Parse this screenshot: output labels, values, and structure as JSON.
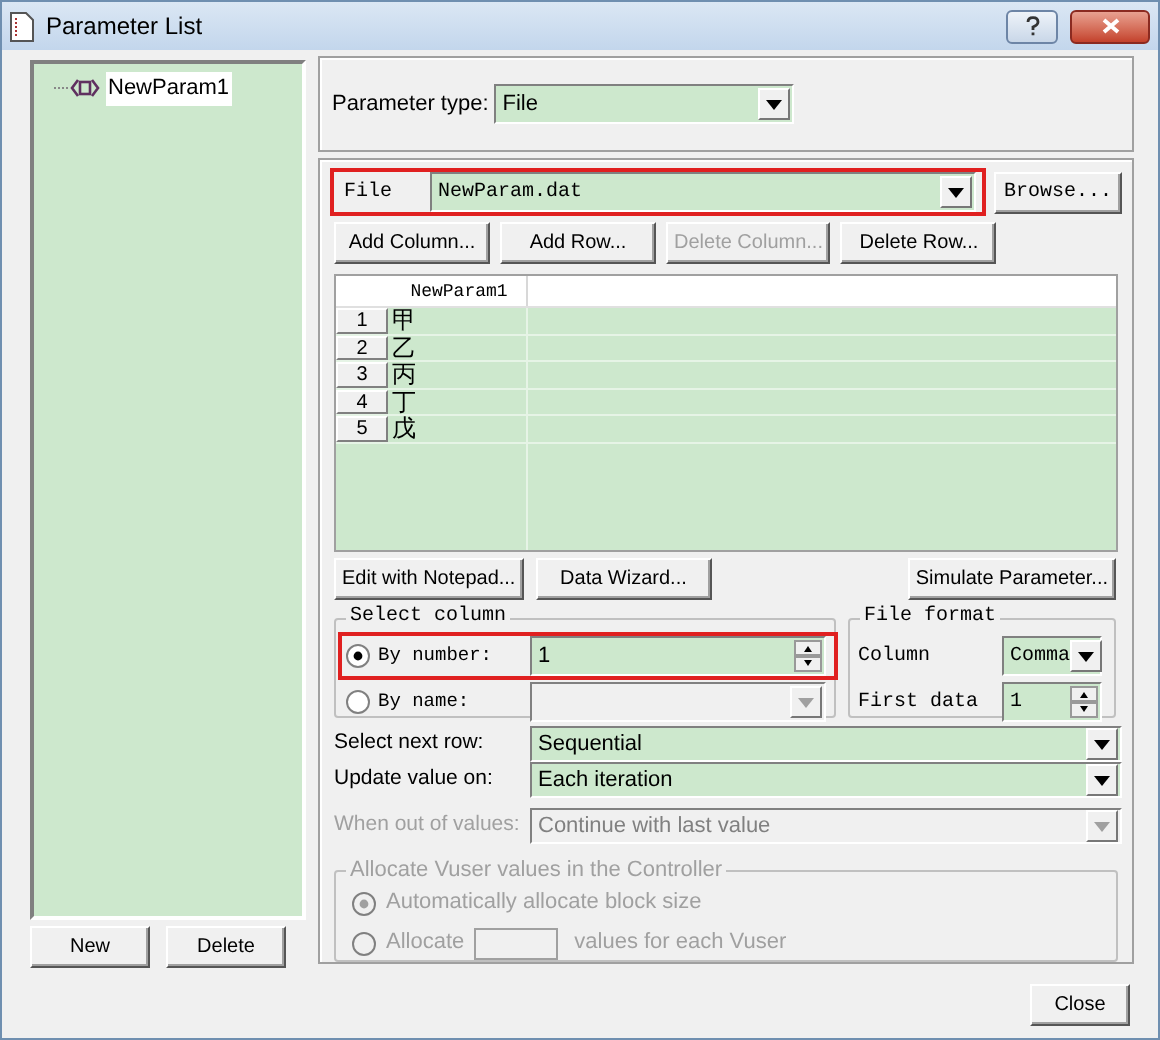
{
  "window": {
    "title": "Parameter List"
  },
  "parameters": [
    {
      "name": "NewParam1",
      "selected": false
    }
  ],
  "list_buttons": [
    "New",
    "Delete"
  ],
  "parameter_type": {
    "label": "Parameter type:",
    "value": "File"
  },
  "file": {
    "label": "File",
    "value": "NewParam.dat",
    "browse": "Browse...",
    "highlighted": true
  },
  "table_buttons": [
    {
      "label": "Add Column...",
      "disabled": false
    },
    {
      "label": "Add Row...",
      "disabled": false
    },
    {
      "label": "Delete Column...",
      "disabled": true
    },
    {
      "label": "Delete Row...",
      "disabled": false
    }
  ],
  "table": {
    "columns": [
      "NewParam1"
    ],
    "rows": [
      {
        "number": "1",
        "cells": [
          "甲"
        ]
      },
      {
        "number": "2",
        "cells": [
          "乙"
        ]
      },
      {
        "number": "3",
        "cells": [
          "丙"
        ]
      },
      {
        "number": "4",
        "cells": [
          "丁"
        ]
      },
      {
        "number": "5",
        "cells": [
          "戊"
        ]
      }
    ]
  },
  "data_buttons": [
    "Edit with Notepad...",
    "Data Wizard...",
    "Simulate Parameter..."
  ],
  "select_column": {
    "title": "Select column",
    "options": [
      {
        "label": "By number:",
        "selected": true,
        "value": "1",
        "disabled": false,
        "highlighted": true
      },
      {
        "label": "By name:",
        "selected": false,
        "disabled": true,
        "highlighted": false
      }
    ]
  },
  "file_format": {
    "title": "File format",
    "fields": [
      {
        "label": "Column",
        "value": "Comma",
        "kind": "dropdown"
      },
      {
        "label": "First data",
        "value": "1",
        "kind": "spinner"
      }
    ]
  },
  "row_settings": [
    {
      "label": "Select next row:",
      "value": "Sequential",
      "disabled": false
    },
    {
      "label": "Update value on:",
      "value": "Each iteration",
      "disabled": false
    },
    {
      "label": "When out of values:",
      "value": "Continue with last value",
      "disabled": true
    }
  ],
  "allocate": {
    "title": "Allocate Vuser values in the Controller",
    "disabled": true,
    "options": [
      {
        "label": "Automatically allocate block size",
        "selected": true
      },
      {
        "label": "Allocate",
        "suffix": "values for each Vuser",
        "selected": false
      }
    ]
  },
  "close_button": "Close"
}
